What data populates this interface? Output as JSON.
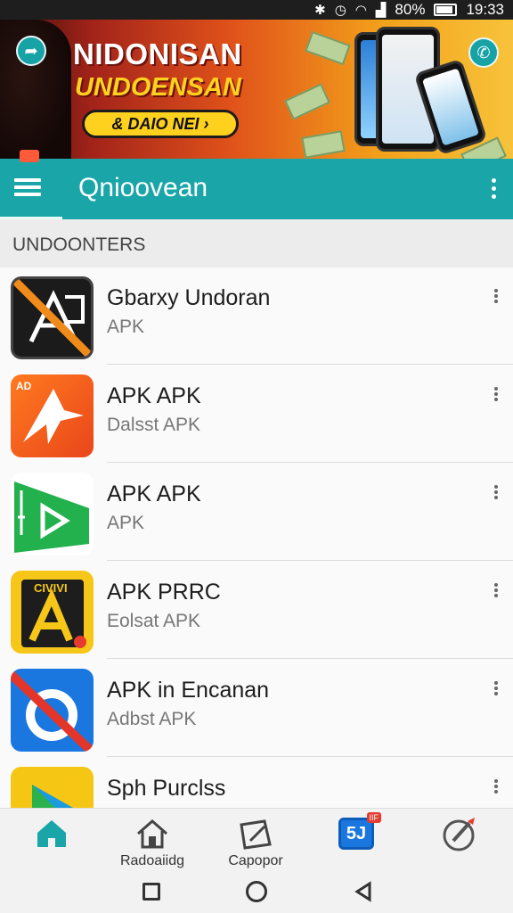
{
  "status_bar": {
    "battery": "80%",
    "time": "19:33"
  },
  "banner": {
    "headline": "NIDONISAN",
    "subheadline": "UNDOENSAN",
    "button_label": "& DAIO NEI ›",
    "left_button_icon": "back-arrow-icon",
    "right_button_icon": "share-icon"
  },
  "toolbar": {
    "title": "Qnioovean",
    "menu_icon": "hamburger-icon",
    "overflow_icon": "more-vert-icon",
    "accent": "#1aa6a8"
  },
  "section": {
    "header": "UNDOONTERS"
  },
  "apps": [
    {
      "name": "Gbarxy Undoran",
      "subtitle": "APK",
      "icon": "black-monogram-icon"
    },
    {
      "name": "APK APK",
      "subtitle": "Dalsst APK",
      "icon": "orange-arrow-icon",
      "icon_badge": "AD"
    },
    {
      "name": "APK APK",
      "subtitle": "APK",
      "icon": "green-play-icon"
    },
    {
      "name": "APK PRRC",
      "subtitle": "Eolsat APK",
      "icon": "yellow-a-icon",
      "icon_badge": "CIVIVI"
    },
    {
      "name": "APK in Encanan",
      "subtitle": "Adbst APK",
      "icon": "blue-s-icon"
    },
    {
      "name": "Sph Purclss",
      "subtitle": "",
      "icon": "play-store-icon"
    }
  ],
  "bottom_nav": [
    {
      "label": "",
      "icon": "home-icon",
      "active": true
    },
    {
      "label": "Radoaiidg",
      "icon": "house-outline-icon"
    },
    {
      "label": "Capopor",
      "icon": "edit-frame-icon"
    },
    {
      "label": "",
      "icon": "app-badge-icon",
      "badge": "IIF"
    },
    {
      "label": "",
      "icon": "settings-pen-icon"
    }
  ],
  "system_nav": [
    "recents-square-icon",
    "home-circle-icon",
    "back-triangle-icon"
  ]
}
